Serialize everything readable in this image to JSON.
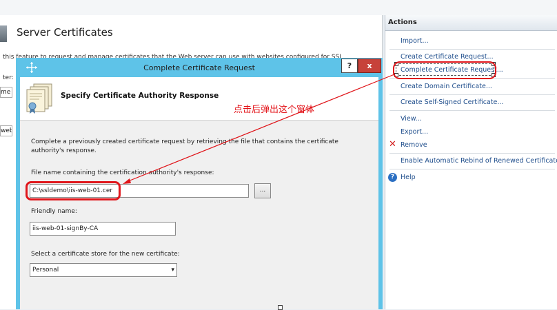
{
  "page": {
    "title": "Server Certificates",
    "description": "this feature to request and manage certificates that the Web server can use with websites configured for SSL",
    "side_labels": [
      "ter:",
      "me",
      "web"
    ]
  },
  "actions": {
    "header": "Actions",
    "items": [
      {
        "label": "Import..."
      },
      {
        "label": "Create Certificate Request..."
      },
      {
        "label": "Complete Certificate Request..."
      },
      {
        "label": "Create Domain Certificate..."
      },
      {
        "label": "Create Self-Signed Certificate..."
      },
      {
        "label": "View..."
      },
      {
        "label": "Export..."
      },
      {
        "label": "Remove"
      },
      {
        "label": "Enable Automatic Rebind of Renewed Certificate"
      },
      {
        "label": "Help"
      }
    ]
  },
  "dialog": {
    "title": "Complete Certificate Request",
    "help_button": "?",
    "close_button": "x",
    "header_title": "Specify Certificate Authority Response",
    "description": "Complete a previously created certificate request by retrieving the file that contains the certificate authority's response.",
    "file_label": "File name containing the certification authority's response:",
    "file_value": "C:\\ssldemo\\iis-web-01.cer",
    "browse_label": "...",
    "friendly_label": "Friendly name:",
    "friendly_value": "iis-web-01-signBy-CA",
    "store_label": "Select a certificate store for the new certificate:",
    "store_value": "Personal"
  },
  "annotation": {
    "text": "点击后弹出这个窗体",
    "color": "#e3141a"
  },
  "colors": {
    "dialog_frame": "#5ec3e8",
    "close_button": "#c7423a",
    "link": "#1f4e8c",
    "highlight": "#e0161b"
  }
}
